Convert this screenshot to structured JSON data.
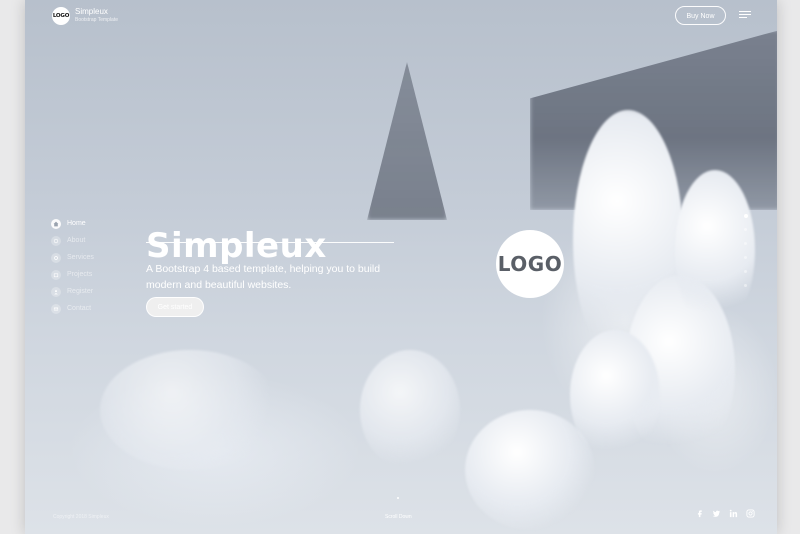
{
  "header": {
    "logo_text": "LOGO",
    "brand_name": "Simpleux",
    "brand_tagline": "Bootstrap Template",
    "buy_label": "Buy Now"
  },
  "sidebar": {
    "items": [
      {
        "label": "Home",
        "active": true,
        "icon": "home-icon"
      },
      {
        "label": "About",
        "active": false,
        "icon": "info-icon"
      },
      {
        "label": "Services",
        "active": false,
        "icon": "gear-icon"
      },
      {
        "label": "Projects",
        "active": false,
        "icon": "briefcase-icon"
      },
      {
        "label": "Register",
        "active": false,
        "icon": "user-icon"
      },
      {
        "label": "Contact",
        "active": false,
        "icon": "envelope-icon"
      }
    ]
  },
  "hero": {
    "title": "Simpleux",
    "subtitle": "A Bootstrap 4 based template, helping you to build modern and beautiful websites.",
    "cta_label": "Get started",
    "center_logo_text": "LOGO"
  },
  "footer": {
    "copyright": "Copyright 2018 Simpleux",
    "scroll_label": "Scroll Down",
    "socials": [
      "facebook-icon",
      "twitter-icon",
      "linkedin-icon",
      "instagram-icon"
    ]
  },
  "colors": {
    "text": "#ffffff",
    "logo_text": "#5a5f67",
    "background_top": "#b7c0cc",
    "background_bottom": "#dde2e8"
  }
}
